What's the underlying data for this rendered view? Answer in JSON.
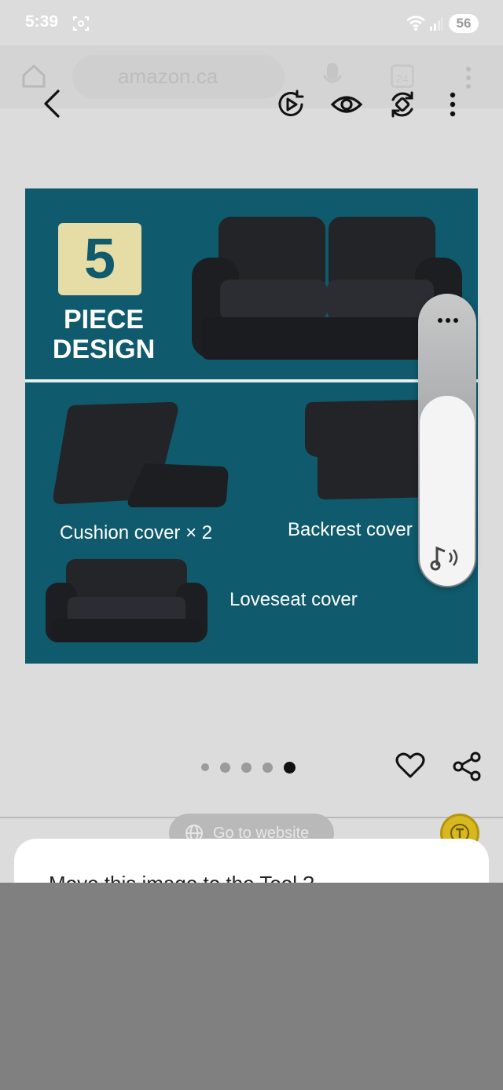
{
  "status_bar": {
    "time": "5:39",
    "battery": "56",
    "icons": [
      "screenshot-icon",
      "wifi-icon",
      "signal-icon",
      "battery-icon"
    ]
  },
  "browser": {
    "url": "amazon.ca",
    "tabs_count": "24"
  },
  "viewer_toolbar": {
    "icons": [
      "back-icon",
      "play-icon",
      "eye-icon",
      "rotate-icon",
      "more-icon"
    ]
  },
  "product_image": {
    "badge_number": "5",
    "headline_line1": "PIECE",
    "headline_line2": "DESIGN",
    "cushion_label": "Cushion cover × 2",
    "backrest_label": "Backrest cover",
    "loveseat_label": "Loveseat cover",
    "background_color": "#0f5a6c",
    "badge_color": "#e6dca6"
  },
  "volume_panel": {
    "level_percent": 65
  },
  "pager": {
    "count": 5,
    "active_index": 4
  },
  "actions": {
    "go_to_website": "Go to website"
  },
  "dialog": {
    "text": "Move this image to the Tool ?"
  },
  "background_fragment": "C"
}
